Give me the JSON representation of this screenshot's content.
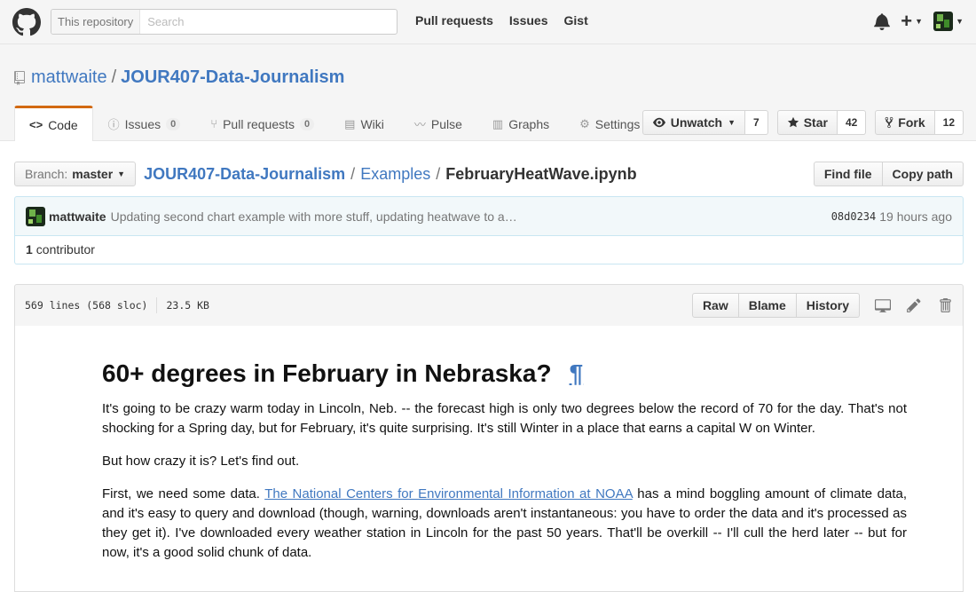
{
  "header": {
    "search_scope": "This repository",
    "search_placeholder": "Search",
    "nav": [
      "Pull requests",
      "Issues",
      "Gist"
    ],
    "plus_label": "+"
  },
  "repo": {
    "owner": "mattwaite",
    "name": "JOUR407-Data-Journalism",
    "watch_label": "Unwatch",
    "watch_count": "7",
    "star_label": "Star",
    "star_count": "42",
    "fork_label": "Fork",
    "fork_count": "12"
  },
  "tabs": [
    {
      "label": "Code",
      "icon": "code-icon",
      "counter": ""
    },
    {
      "label": "Issues",
      "icon": "issue-icon",
      "counter": "0"
    },
    {
      "label": "Pull requests",
      "icon": "pull-request-icon",
      "counter": "0"
    },
    {
      "label": "Wiki",
      "icon": "book-icon",
      "counter": ""
    },
    {
      "label": "Pulse",
      "icon": "pulse-icon",
      "counter": ""
    },
    {
      "label": "Graphs",
      "icon": "graph-icon",
      "counter": ""
    },
    {
      "label": "Settings",
      "icon": "gear-icon",
      "counter": ""
    }
  ],
  "filenav": {
    "branch_prefix": "Branch:",
    "branch": "master",
    "crumb_repo": "JOUR407-Data-Journalism",
    "crumb_dir": "Examples",
    "crumb_file": "FebruaryHeatWave.ipynb",
    "find_file": "Find file",
    "copy_path": "Copy path"
  },
  "commit": {
    "author": "mattwaite",
    "message": "Updating second chart example with more stuff, updating heatwave to a…",
    "sha": "08d0234",
    "time": "19 hours ago",
    "contributors_count": "1",
    "contributors_label": "contributor"
  },
  "file": {
    "lines": "569 lines (568 sloc)",
    "size": "23.5 KB",
    "raw": "Raw",
    "blame": "Blame",
    "history": "History"
  },
  "content": {
    "heading": "60+ degrees in February in Nebraska?",
    "pilcrow": "¶",
    "p1": "It's going to be crazy warm today in Lincoln, Neb. -- the forecast high is only two degrees below the record of 70 for the day. That's not shocking for a Spring day, but for February, it's quite surprising. It's still Winter in a place that earns a capital W on Winter.",
    "p2": "But how crazy it is? Let's find out.",
    "p3_before": "First, we need some data. ",
    "p3_link": "The National Centers for Environmental Information at NOAA",
    "p3_after": " has a mind boggling amount of climate data, and it's easy to query and download (though, warning, downloads aren't instantaneous: you have to order the data and it's processed as they get it). I've downloaded every weather station in Lincoln for the past 50 years. That'll be overkill -- I'll cull the herd later -- but for now, it's a good solid chunk of data."
  },
  "colors": {
    "link": "#4078c0",
    "active_tab_accent": "#d26911",
    "commit_bg": "#f2f8fa"
  }
}
